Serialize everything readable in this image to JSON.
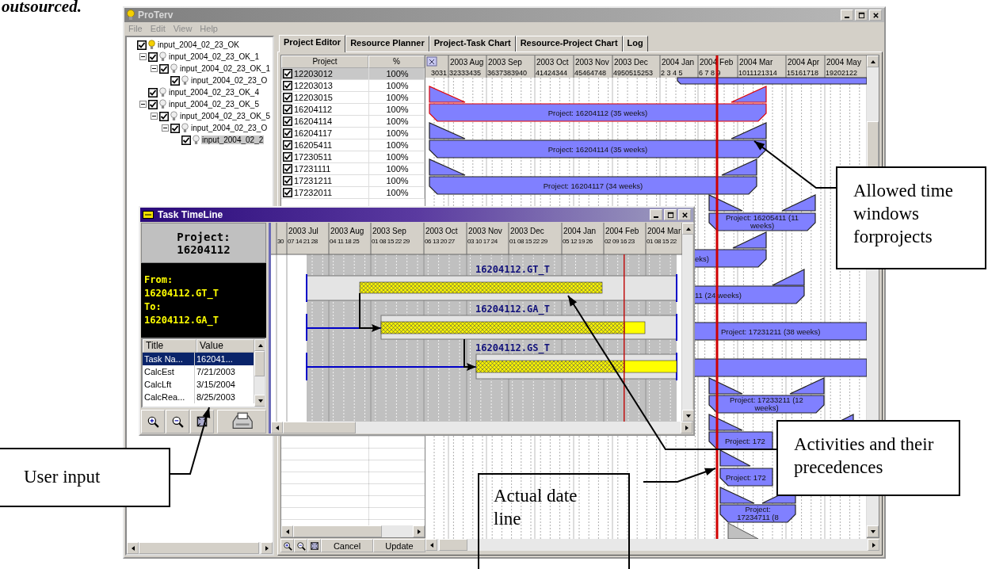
{
  "page_caption": "outsourced.",
  "window": {
    "title": "ProTerv",
    "menu": [
      "File",
      "Edit",
      "View",
      "Help"
    ]
  },
  "tree": [
    {
      "label": "input_2004_02_23_OK",
      "checked": true,
      "lit": true,
      "selected": false,
      "children": [
        {
          "label": "input_2004_02_23_OK_1",
          "checked": true,
          "lit": false,
          "selected": false,
          "expanded": true,
          "children": [
            {
              "label": "input_2004_02_23_OK_1",
              "checked": true,
              "lit": false,
              "selected": false,
              "expanded": true,
              "children": [
                {
                  "label": "input_2004_02_23_O",
                  "checked": true,
                  "lit": false,
                  "selected": false
                }
              ]
            }
          ]
        },
        {
          "label": "input_2004_02_23_OK_4",
          "checked": true,
          "lit": false,
          "selected": false
        },
        {
          "label": "input_2004_02_23_OK_5",
          "checked": true,
          "lit": false,
          "selected": false,
          "expanded": true,
          "children": [
            {
              "label": "input_2004_02_23_OK_5",
              "checked": true,
              "lit": false,
              "selected": false,
              "expanded": true,
              "children": [
                {
                  "label": "input_2004_02_23_O",
                  "checked": true,
                  "lit": false,
                  "selected": false,
                  "expanded": true,
                  "children": [
                    {
                      "label": "input_2004_02_2",
                      "checked": true,
                      "lit": false,
                      "selected": true
                    }
                  ]
                }
              ]
            }
          ]
        }
      ]
    }
  ],
  "tabs": [
    {
      "label": "Project Editor",
      "selected": true
    },
    {
      "label": "Resource Planner",
      "selected": false
    },
    {
      "label": "Project-Task Chart",
      "selected": false
    },
    {
      "label": "Resource-Project Chart",
      "selected": false
    },
    {
      "label": "Log",
      "selected": false
    }
  ],
  "project_table": {
    "columns": [
      "Project",
      "%"
    ],
    "rows": [
      {
        "project": "12203012",
        "percent": "100%",
        "checked": true,
        "selected": true
      },
      {
        "project": "12203013",
        "percent": "100%",
        "checked": true,
        "selected": false
      },
      {
        "project": "12203015",
        "percent": "100%",
        "checked": true,
        "selected": false
      },
      {
        "project": "16204112",
        "percent": "100%",
        "checked": true,
        "selected": false
      },
      {
        "project": "16204114",
        "percent": "100%",
        "checked": true,
        "selected": false
      },
      {
        "project": "16204117",
        "percent": "100%",
        "checked": true,
        "selected": false
      },
      {
        "project": "16205411",
        "percent": "100%",
        "checked": true,
        "selected": false
      },
      {
        "project": "17230511",
        "percent": "100%",
        "checked": true,
        "selected": false
      },
      {
        "project": "17231111",
        "percent": "100%",
        "checked": true,
        "selected": false
      },
      {
        "project": "17231211",
        "percent": "100%",
        "checked": true,
        "selected": false
      },
      {
        "project": "17232011",
        "percent": "100%",
        "checked": true,
        "selected": false
      }
    ]
  },
  "gantt": {
    "first_weeks": "3031",
    "months": [
      {
        "label": "2003 Aug",
        "weeks": "32333435"
      },
      {
        "label": "2003 Sep",
        "weeks": "3637383940"
      },
      {
        "label": "2003 Oct",
        "weeks": "41424344"
      },
      {
        "label": "2003 Nov",
        "weeks": "45464748"
      },
      {
        "label": "2003 Dec",
        "weeks": "4950515253"
      },
      {
        "label": "2004 Jan",
        "weeks": "2 3 4 5"
      },
      {
        "label": "2004 Feb",
        "weeks": "6 7 8 9"
      },
      {
        "label": "2004 Mar",
        "weeks": "1011121314"
      },
      {
        "label": "2004 Apr",
        "weeks": "15161718"
      },
      {
        "label": "2004 May",
        "weeks": "19202122"
      }
    ],
    "bars": [
      {
        "lines": [
          "Project: 16204112 (35 weeks)"
        ],
        "highlighted": true
      },
      {
        "lines": [
          "Project: 16204114 (35 weeks)"
        ],
        "highlighted": false
      },
      {
        "lines": [
          "Project: 16204117 (34 weeks)"
        ],
        "highlighted": false
      },
      {
        "lines": [
          "Project: 16205411 (11",
          "weeks)"
        ],
        "highlighted": false
      },
      {
        "lines": [
          "eks)"
        ],
        "highlighted": false
      },
      {
        "lines": [
          "11 (24 weeks)"
        ],
        "highlighted": false
      },
      {
        "lines": [
          "Project: 17231211 (38 weeks)"
        ],
        "highlighted": false
      },
      {
        "lines": [
          "Project: 17233211 (12",
          "weeks)"
        ],
        "highlighted": false
      },
      {
        "lines": [
          "Project: 172"
        ],
        "highlighted": false
      },
      {
        "lines": [
          "Project: 172"
        ],
        "highlighted": false
      },
      {
        "lines": [
          "Project:",
          "17234711 (8"
        ],
        "highlighted": false
      }
    ]
  },
  "toolbar": {
    "buttons": [
      "Cancel",
      "Update"
    ]
  },
  "task_timeline": {
    "title": "Task TimeLine",
    "project_label": "Project:",
    "project_id": "16204112",
    "link": [
      "From:",
      "16204112.GT_T",
      "To:",
      "16204112.GA_T"
    ],
    "table": {
      "columns": [
        "Title",
        "Value"
      ],
      "rows": [
        {
          "title": "Task Na...",
          "value": "162041...",
          "selected": true
        },
        {
          "title": "CalcEst",
          "value": "7/21/2003",
          "selected": false
        },
        {
          "title": "CalcLft",
          "value": "3/15/2004",
          "selected": false
        },
        {
          "title": "CalcRea...",
          "value": "8/25/2003",
          "selected": false
        }
      ]
    },
    "first_weeks": "30",
    "months": [
      {
        "label": "2003 Jul",
        "weeks": "07 14 21 28"
      },
      {
        "label": "2003 Aug",
        "weeks": "04 11 18 25"
      },
      {
        "label": "2003 Sep",
        "weeks": "01 08 15 22 29"
      },
      {
        "label": "2003 Oct",
        "weeks": "06 13 20 27"
      },
      {
        "label": "2003 Nov",
        "weeks": "03 10 17 24"
      },
      {
        "label": "2003 Dec",
        "weeks": "01 08 15 22 29"
      },
      {
        "label": "2004 Jan",
        "weeks": "05 12 19 26"
      },
      {
        "label": "2004 Feb",
        "weeks": "02 09 16 23"
      },
      {
        "label": "2004 Mar",
        "weeks": "01 08 15 22"
      }
    ],
    "tasks": [
      {
        "label": "16204112.GT_T"
      },
      {
        "label": "16204112.GA_T"
      },
      {
        "label": "16204112.GS_T"
      }
    ]
  },
  "annotations": [
    {
      "text": "Allowed time windows forprojects"
    },
    {
      "text": "Activities and their precedences"
    },
    {
      "text": "User input"
    },
    {
      "text": "Actual date line"
    }
  ]
}
